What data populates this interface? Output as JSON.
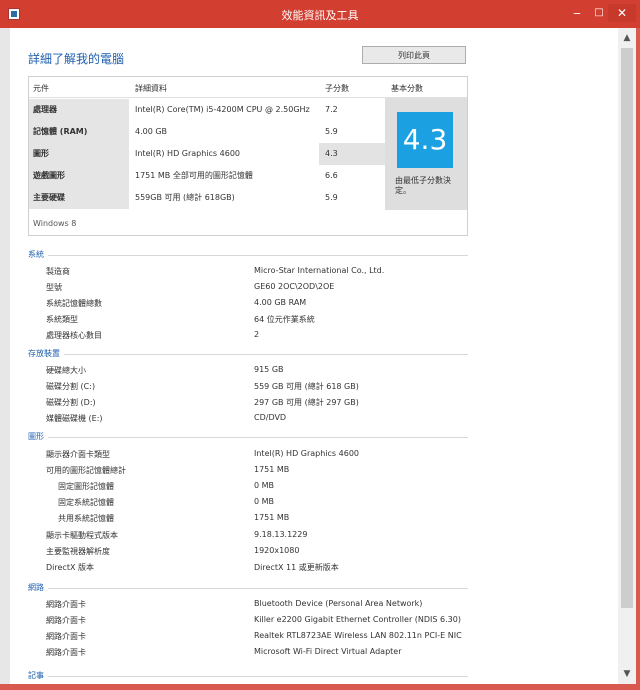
{
  "window": {
    "title": "效能資訊及工具"
  },
  "window_controls": {
    "minimize": "‒",
    "maximize": "□",
    "close": "✕"
  },
  "page": {
    "heading": "詳細了解我的電腦",
    "print_button": "列印此頁"
  },
  "summary": {
    "columns": {
      "component": "元件",
      "details": "詳細資料",
      "subscore": "子分數",
      "basescore": "基本分數"
    },
    "rows": [
      {
        "label": "處理器",
        "detail": "Intel(R) Core(TM) i5-4200M CPU @ 2.50GHz",
        "score": "7.2"
      },
      {
        "label": "記憶體 (RAM)",
        "detail": "4.00 GB",
        "score": "5.9"
      },
      {
        "label": "圖形",
        "detail": "Intel(R) HD Graphics 4600",
        "score": "4.3"
      },
      {
        "label": "遊戲圖形",
        "detail": "1751 MB 全部可用的圖形記憶體",
        "score": "6.6"
      },
      {
        "label": "主要硬碟",
        "detail": "559GB 可用 (總計 618GB)",
        "score": "5.9"
      }
    ],
    "base_score": "4.3",
    "base_note": "由最低子分數決定。",
    "os": "Windows 8"
  },
  "sections": [
    {
      "title": "系統",
      "rows": [
        {
          "key": "製造商",
          "value": "Micro-Star International Co., Ltd."
        },
        {
          "key": "型號",
          "value": "GE60 2OC\\2OD\\2OE"
        },
        {
          "key": "系統記憶體總數",
          "value": "4.00 GB RAM"
        },
        {
          "key": "系統類型",
          "value": "64 位元作業系統"
        },
        {
          "key": "處理器核心數目",
          "value": "2"
        }
      ]
    },
    {
      "title": "存放裝置",
      "rows": [
        {
          "key": "硬碟總大小",
          "value": "915 GB"
        },
        {
          "key": "磁碟分割 (C:)",
          "value": "559 GB 可用 (總計 618 GB)"
        },
        {
          "key": "磁碟分割 (D:)",
          "value": "297 GB 可用 (總計 297 GB)"
        },
        {
          "key": "媒體磁碟機 (E:)",
          "value": "CD/DVD"
        }
      ]
    },
    {
      "title": "圖形",
      "rows": [
        {
          "key": "顯示器介面卡類型",
          "value": "Intel(R) HD Graphics 4600"
        },
        {
          "key": "可用的圖形記憶體總計",
          "value": "1751 MB"
        },
        {
          "key": "固定圖形記憶體",
          "value": "0 MB"
        },
        {
          "key": "固定系統記憶體",
          "value": "0 MB"
        },
        {
          "key": "共用系統記憶體",
          "value": "1751 MB"
        },
        {
          "key": "顯示卡驅動程式版本",
          "value": "9.18.13.1229"
        },
        {
          "key": "主要監視器解析度",
          "value": "1920x1080"
        },
        {
          "key": "DirectX 版本",
          "value": "DirectX 11 或更新版本"
        }
      ]
    },
    {
      "title": "網路",
      "rows": [
        {
          "key": "網路介面卡",
          "value": "Bluetooth Device (Personal Area Network)"
        },
        {
          "key": "網路介面卡",
          "value": "Killer e2200 Gigabit Ethernet Controller (NDIS 6.30)"
        },
        {
          "key": "網路介面卡",
          "value": "Realtek RTL8723AE Wireless LAN 802.11n PCI-E NIC"
        },
        {
          "key": "網路介面卡",
          "value": "Microsoft Wi-Fi Direct Virtual Adapter"
        }
      ]
    },
    {
      "title": "記事",
      "rows": []
    }
  ],
  "colors": {
    "title_bar": "#d23f31",
    "accent_blue": "#1e5fae",
    "score_tile": "#1ba1e2"
  }
}
